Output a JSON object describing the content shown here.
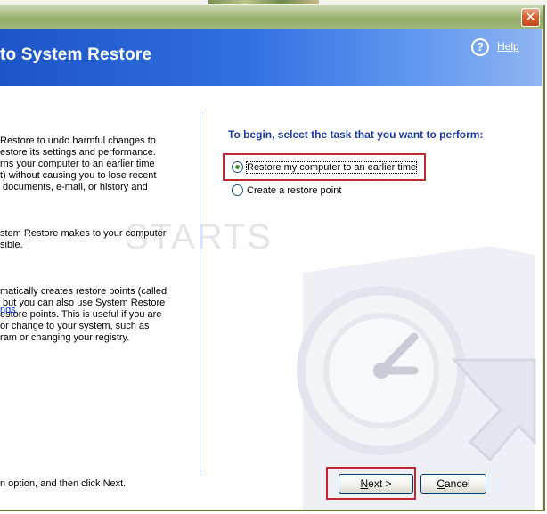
{
  "titlebar": {
    "close_label": "✕"
  },
  "header": {
    "title": "to System Restore",
    "help_label": "Help",
    "help_icon": "?"
  },
  "left_panel": {
    "paragraphs": [
      "Restore to undo harmful changes to\nestore its settings and performance.\nrns your computer to an earlier time\nt) without causing you to lose recent\n documents, e-mail, or history and",
      "stem Restore makes to your computer\nsible.",
      "matically creates restore points (called\n but you can also use System Restore\nestore points. This is useful if you are\nor change to your system, such as\nram or changing your registry."
    ],
    "link_text": "ngs",
    "instruction": "n option, and then click Next."
  },
  "right_panel": {
    "heading": "To begin, select the task that you want to perform:",
    "options": [
      {
        "label": "Restore my computer to an earlier time",
        "selected": true
      },
      {
        "label": "Create a restore point",
        "selected": false
      }
    ]
  },
  "watermark": "STARTS",
  "buttons": {
    "next": {
      "accel": "N",
      "rest": "ext >"
    },
    "cancel": {
      "accel": "C",
      "rest": "ancel"
    }
  },
  "colors": {
    "header_blue": "#2f6fe0",
    "highlight_red": "#c0282f",
    "link_blue": "#0033cc",
    "heading_blue": "#1b3aa0"
  }
}
